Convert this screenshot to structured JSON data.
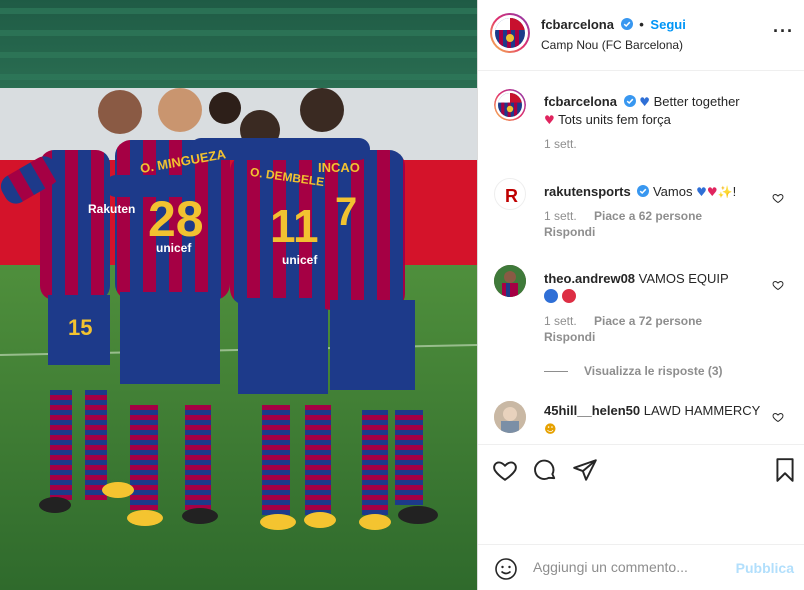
{
  "header": {
    "username": "fcbarcelona",
    "separator": "•",
    "follow_label": "Segui",
    "location": "Camp Nou (FC Barcelona)",
    "more_icon": "more-options-icon"
  },
  "caption": {
    "username": "fcbarcelona",
    "line1": "Better together",
    "line2": "Tots units fem força",
    "time": "1 sett."
  },
  "comments": [
    {
      "username": "rakutensports",
      "text": "Vamos",
      "time": "1 sett.",
      "likes": "Piace a 62 persone",
      "reply": "Rispondi"
    },
    {
      "username": "theo.andrew08",
      "text": "VAMOS EQUIP",
      "time": "1 sett.",
      "likes": "Piace a 72 persone",
      "reply": "Rispondi"
    },
    {
      "username": "45hill__helen50",
      "text": "LAWD HAMMERCY"
    }
  ],
  "view_replies": "Visualizza le risposte (3)",
  "photo": {
    "shirt_numbers": [
      "15",
      "28",
      "11",
      "7"
    ],
    "shirt_names": [
      "O. MINGUEZA",
      "O. DEMBELE",
      "INCAO"
    ],
    "sponsor": "Rakuten",
    "kit_brand": "unicef"
  },
  "add_comment": {
    "placeholder": "Aggiungi un commento...",
    "publish_label": "Pubblica"
  },
  "colors": {
    "accent": "#0095f6",
    "publish_disabled": "#b2dffc",
    "blaugrana_blue": "#1d3a8a",
    "blaugrana_red": "#a50044",
    "gold": "#f2c230"
  }
}
